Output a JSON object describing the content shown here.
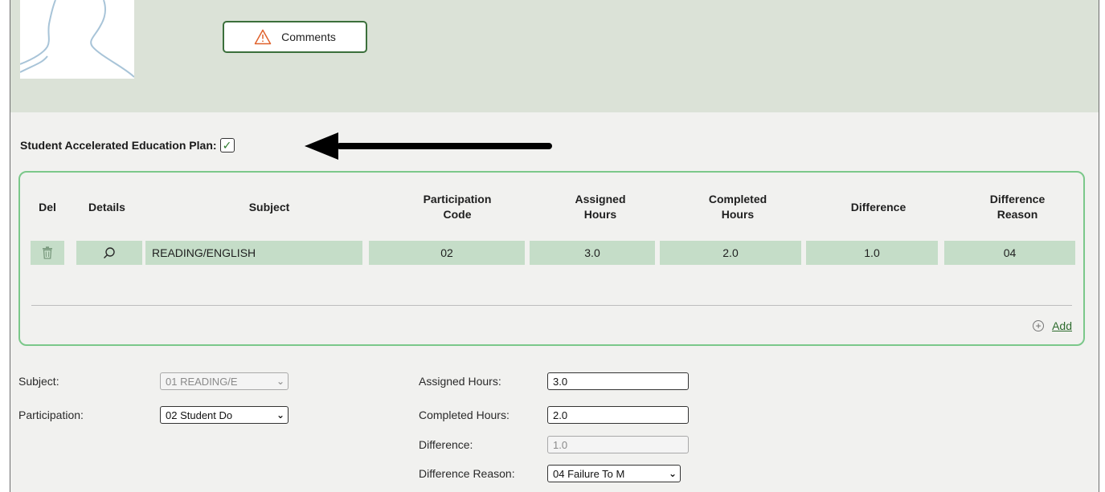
{
  "header": {
    "comments_label": "Comments"
  },
  "plan": {
    "label": "Student Accelerated Education Plan:",
    "checked": "✓"
  },
  "grid": {
    "columns": [
      "Del",
      "Details",
      "Subject",
      "Participation Code",
      "Assigned Hours",
      "Completed Hours",
      "Difference",
      "Difference Reason"
    ],
    "column_lines": {
      "participation": [
        "Participation",
        "Code"
      ],
      "assigned": [
        "Assigned",
        "Hours"
      ],
      "completed": [
        "Completed",
        "Hours"
      ],
      "reason": [
        "Difference",
        "Reason"
      ]
    },
    "rows": [
      {
        "subject": "READING/ENGLISH",
        "participation_code": "02",
        "assigned_hours": "3.0",
        "completed_hours": "2.0",
        "difference": "1.0",
        "difference_reason": "04"
      }
    ],
    "add_label": "Add"
  },
  "form": {
    "subject_label": "Subject:",
    "subject_value": "01  READING/E",
    "participation_label": "Participation:",
    "participation_value": "02  Student Do",
    "assigned_label": "Assigned Hours:",
    "assigned_value": "3.0",
    "completed_label": "Completed Hours:",
    "completed_value": "2.0",
    "difference_label": "Difference:",
    "difference_value": "1.0",
    "reason_label": "Difference Reason:",
    "reason_value": "04  Failure To M"
  },
  "colors": {
    "header_band": "#dbe2d7",
    "grid_border": "#7bc88a",
    "row_fill": "#c5ddc8",
    "button_border": "#3b6f3b",
    "warning": "#e0612b"
  }
}
